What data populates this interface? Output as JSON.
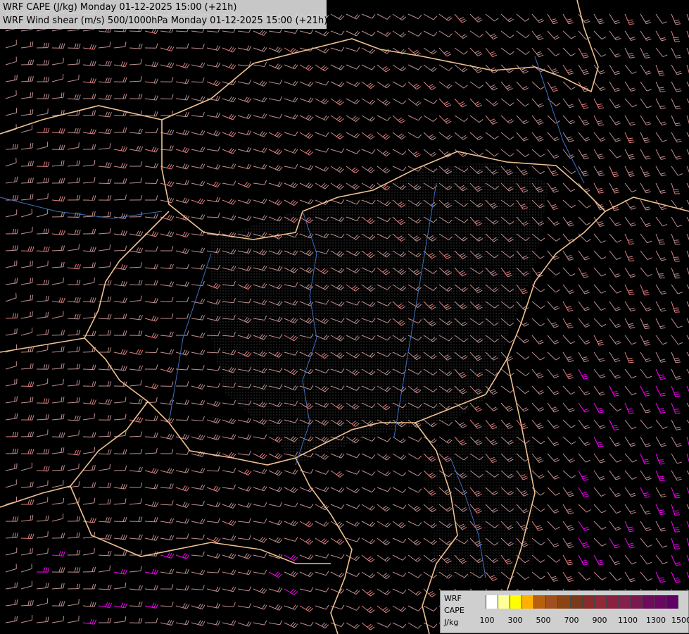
{
  "title": {
    "line1": "WRF CAPE (J/kg) Monday 01-12-2025 15:00 (+21h)",
    "line2": "WRF Wind shear (m/s) 500/1000hPa Monday 01-12-2025 15:00 (+21h)"
  },
  "legend": {
    "label1": "WRF",
    "label2": "CAPE",
    "label3": "J/kg",
    "colors": [
      "#cfcfcf",
      "#ffffff",
      "#ffff99",
      "#ffff00",
      "#ffb000",
      "#b86010",
      "#a05020",
      "#8b4513",
      "#7a3a1a",
      "#8a2a2a",
      "#902838",
      "#8c2040",
      "#85204a",
      "#7a1850",
      "#700a5a",
      "#6a0860",
      "#600066"
    ],
    "ticks": [
      "100",
      "300",
      "500",
      "700",
      "900",
      "1100",
      "1300",
      "1500"
    ]
  },
  "map": {
    "background": "#000000",
    "border_color": "#f0c090",
    "river_color": "#4070c0",
    "barb_low": "#c09090",
    "barb_mid": "#e08080",
    "barb_high": "#ff00ff"
  }
}
